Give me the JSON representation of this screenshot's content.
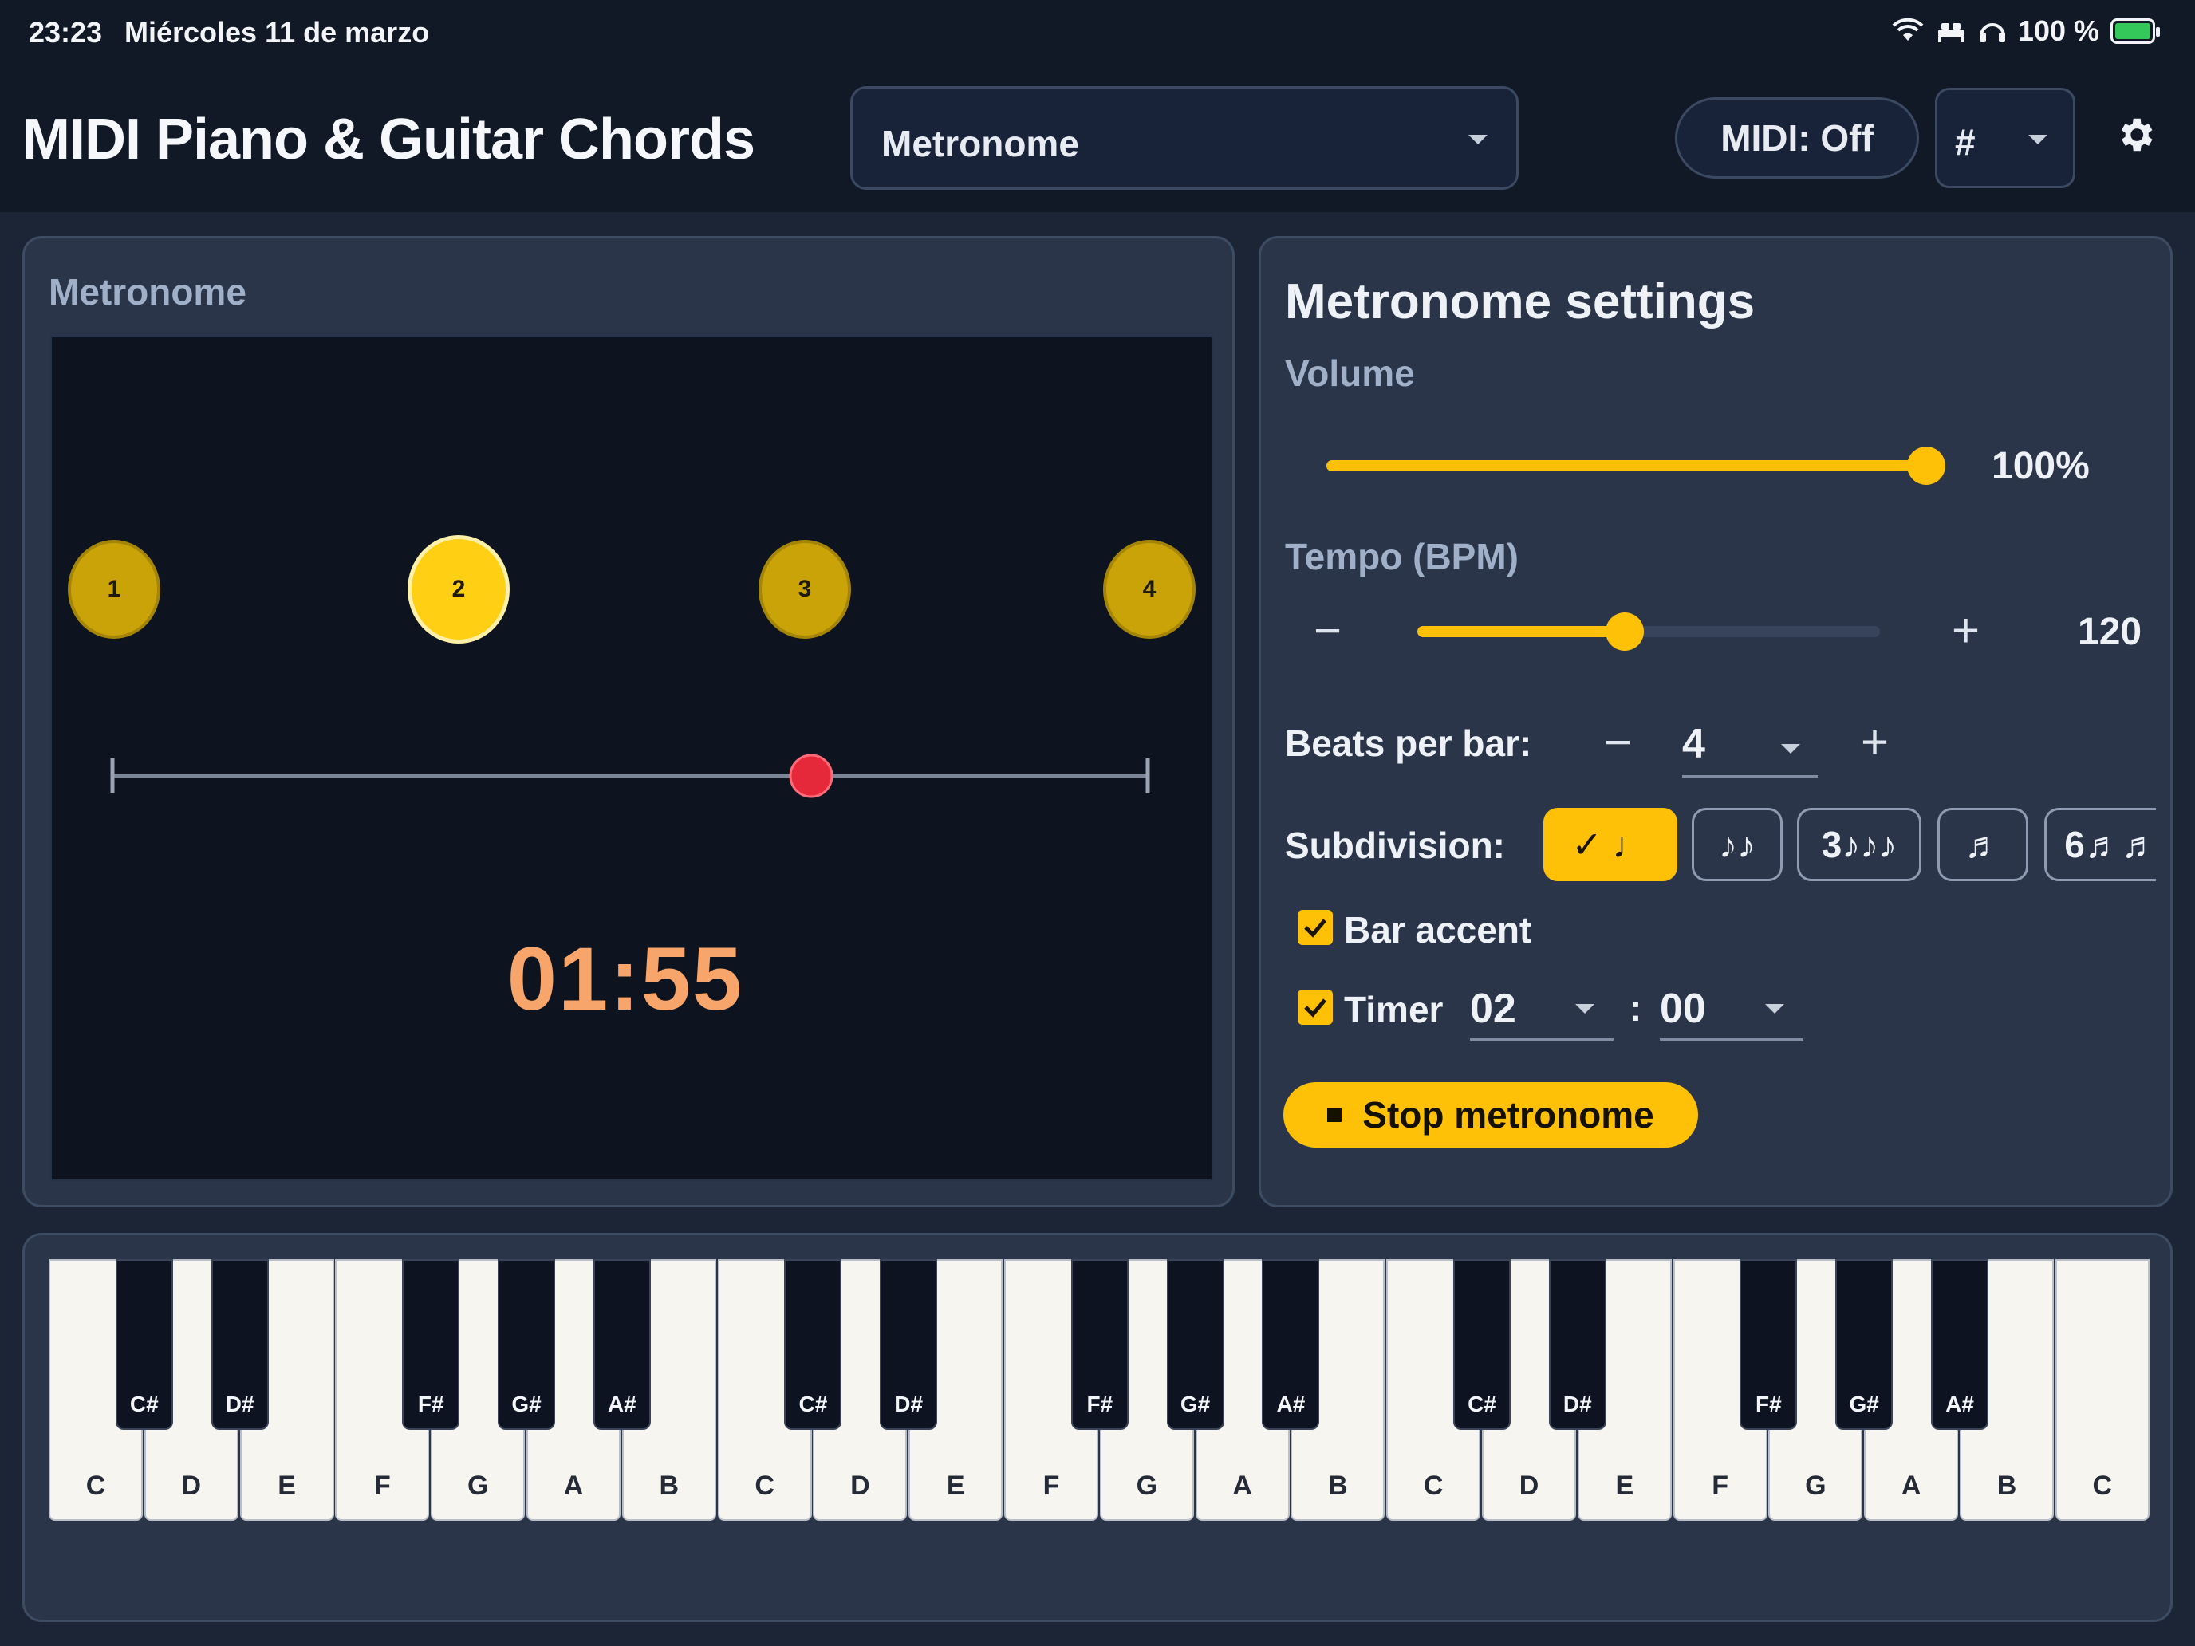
{
  "status_bar": {
    "time": "23:23",
    "date": "Miércoles 11 de marzo",
    "battery": "100 %"
  },
  "app": {
    "title": "MIDI Piano & Guitar Chords",
    "mode_select": "Metronome",
    "midi_button": "MIDI: Off",
    "accidental_select": "#"
  },
  "metronome": {
    "label": "Metronome",
    "beats": [
      "1",
      "2",
      "3",
      "4"
    ],
    "active_beat": "2",
    "pendulum_position": 0.67,
    "timer_remaining": "01:55"
  },
  "settings": {
    "title": "Metronome settings",
    "volume_label": "Volume",
    "volume_value": "100%",
    "volume_level": 1.0,
    "tempo_label": "Tempo (BPM)",
    "tempo_value": "120",
    "tempo_minus": "−",
    "tempo_plus": "+",
    "beats_per_bar_label": "Beats per bar:",
    "beats_per_bar_value": "4",
    "beats_minus": "−",
    "beats_plus": "+",
    "subdivision_label": "Subdivision:",
    "subdivisions": [
      {
        "label": "✓ ♩",
        "selected": true
      },
      {
        "label": "♪♪",
        "selected": false
      },
      {
        "label": "3♪♪♪",
        "selected": false
      },
      {
        "label": "♬",
        "selected": false
      },
      {
        "label": "6♬♬",
        "selected": false
      }
    ],
    "bar_accent_label": "Bar accent",
    "bar_accent_checked": true,
    "timer_label": "Timer",
    "timer_checked": true,
    "timer_minutes": "02",
    "timer_separator": ":",
    "timer_seconds": "00",
    "stop_button": "Stop metronome"
  },
  "piano": {
    "white_keys": [
      "C",
      "D",
      "E",
      "F",
      "G",
      "A",
      "B",
      "C",
      "D",
      "E",
      "F",
      "G",
      "A",
      "B",
      "C",
      "D",
      "E",
      "F",
      "G",
      "A",
      "B",
      "C"
    ],
    "black_keys": [
      "C#",
      "D#",
      "F#",
      "G#",
      "A#",
      "C#",
      "D#",
      "F#",
      "G#",
      "A#",
      "C#",
      "D#",
      "F#",
      "G#",
      "A#"
    ]
  },
  "colors": {
    "accent": "#ffc107",
    "beat_dim": "#c9a308",
    "beat_active": "#ffcf14",
    "pendulum": "#e5293b",
    "timer_text": "#f7a56a",
    "background": "#1b2536",
    "panel": "#2a3549"
  }
}
